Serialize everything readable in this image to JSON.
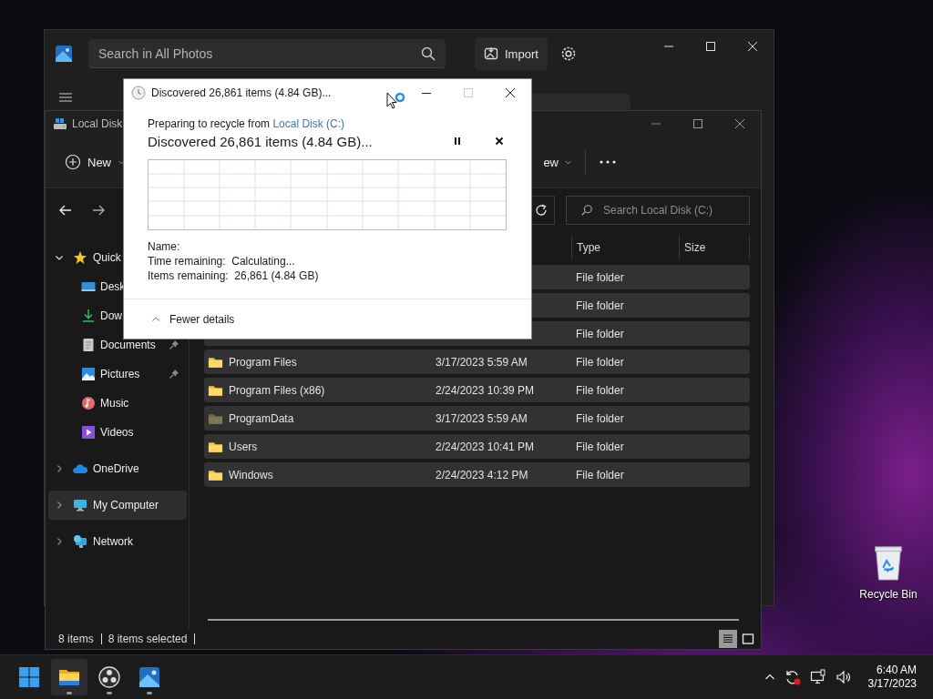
{
  "photos_window": {
    "search": {
      "placeholder": "Search in All Photos"
    },
    "import_button": "Import"
  },
  "explorer": {
    "title": "Local Disk",
    "toolbar_buttons": [
      {
        "label": "New",
        "kind": "new"
      },
      {
        "label": "ew",
        "kind": "menu"
      }
    ],
    "search": {
      "placeholder": "Search Local Disk (C:)"
    },
    "sidebar": {
      "items": [
        {
          "label": "Quick",
          "kind": "star",
          "expanded": true,
          "selected": false,
          "children": [
            {
              "label": "Desk",
              "kind": "desktop",
              "pinned": false,
              "selected": false
            },
            {
              "label": "Dow",
              "kind": "download",
              "pinned": false,
              "selected": false
            },
            {
              "label": "Documents",
              "kind": "documents",
              "pinned": true,
              "selected": false
            },
            {
              "label": "Pictures",
              "kind": "pictures",
              "pinned": true,
              "selected": false
            },
            {
              "label": "Music",
              "kind": "music",
              "pinned": false,
              "selected": false
            },
            {
              "label": "Videos",
              "kind": "videos",
              "pinned": false,
              "selected": false
            }
          ]
        },
        {
          "label": "OneDrive",
          "kind": "cloud",
          "expanded": false,
          "selected": false
        },
        {
          "label": "My Computer",
          "kind": "computer",
          "expanded": false,
          "selected": true
        },
        {
          "label": "Network",
          "kind": "network",
          "expanded": false,
          "selected": false
        }
      ]
    },
    "table": {
      "columns": [
        "Type",
        "Size"
      ],
      "rows": [
        {
          "type": "File folder",
          "selected": true
        },
        {
          "type": "File folder",
          "selected": true
        },
        {
          "type": "File folder",
          "selected": true
        },
        {
          "name": "Program Files",
          "date": "3/17/2023 5:59 AM",
          "type": "File folder",
          "hidden": false,
          "selected": true
        },
        {
          "name": "Program Files (x86)",
          "date": "2/24/2023 10:39 PM",
          "type": "File folder",
          "hidden": false,
          "selected": true
        },
        {
          "name": "ProgramData",
          "date": "3/17/2023 5:59 AM",
          "type": "File folder",
          "hidden": true,
          "selected": true
        },
        {
          "name": "Users",
          "date": "2/24/2023 10:41 PM",
          "type": "File folder",
          "hidden": false,
          "selected": true
        },
        {
          "name": "Windows",
          "date": "2/24/2023 4:12 PM",
          "type": "File folder",
          "hidden": false,
          "selected": true
        }
      ]
    },
    "status_bar": [
      "8 items",
      "8 items selected"
    ],
    "view_buttons": [
      {
        "kind": "details",
        "selected": true
      },
      {
        "kind": "tiles",
        "selected": false
      }
    ]
  },
  "dialog": {
    "title": "Discovered 26,861 items (4.84 GB)...",
    "source_prefix": "Preparing to recycle from",
    "source_link": "Local Disk (C:)",
    "heading": "Discovered 26,861 items (4.84 GB)...",
    "details": [
      {
        "label": "Name:"
      },
      {
        "label": "Time remaining:",
        "value": "Calculating..."
      },
      {
        "label": "Items remaining:",
        "value": "26,861 (4.84 GB)"
      }
    ],
    "details_toggle": {
      "label": "Fewer details",
      "expanded": true
    }
  },
  "desktop_icons": [
    {
      "label": "Recycle Bin"
    }
  ],
  "taskbar": {
    "apps": [
      {
        "kind": "start",
        "selected": false
      },
      {
        "kind": "folder",
        "selected": true,
        "running": true
      },
      {
        "kind": "obs",
        "selected": false,
        "running": true
      },
      {
        "kind": "photos",
        "selected": false,
        "running": true
      }
    ],
    "clock": {
      "time": "6:40 AM",
      "date": "3/17/2023"
    }
  }
}
